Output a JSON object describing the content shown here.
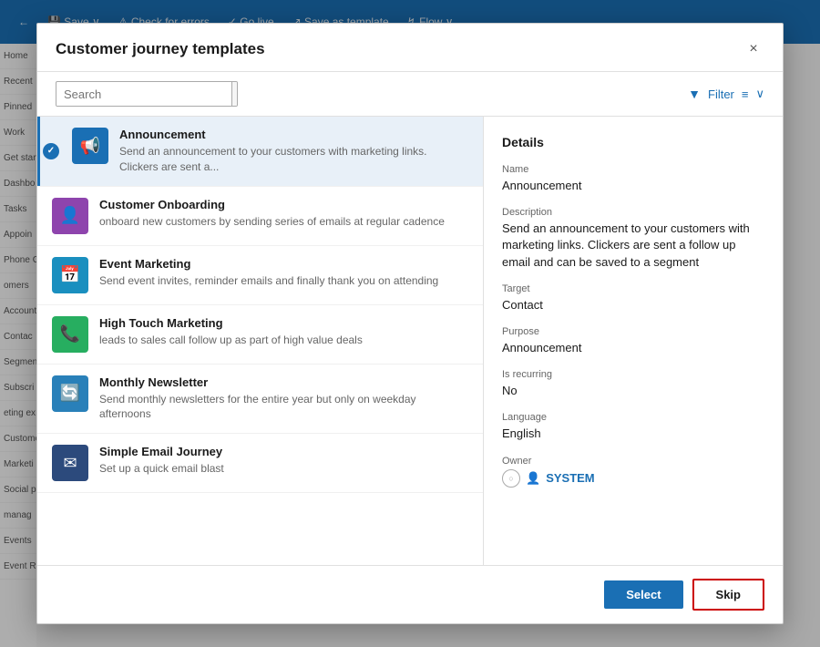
{
  "app": {
    "title": "Customer journey templates",
    "toolbar": {
      "back_label": "←",
      "save_label": "Save",
      "check_errors_label": "Check for errors",
      "go_live_label": "Go live",
      "save_as_template_label": "Save as template",
      "flow_label": "Flow"
    }
  },
  "sidebar": {
    "items": [
      {
        "label": "Home"
      },
      {
        "label": "Recent"
      },
      {
        "label": "Pinned"
      },
      {
        "label": "Work"
      },
      {
        "label": "Get start"
      },
      {
        "label": "Dashbo"
      },
      {
        "label": "Tasks"
      },
      {
        "label": "Appoin"
      },
      {
        "label": "Phone C"
      },
      {
        "label": "omers"
      },
      {
        "label": "Account"
      },
      {
        "label": "Contac"
      },
      {
        "label": "Segmen"
      },
      {
        "label": "Subscri"
      },
      {
        "label": "eting ex"
      },
      {
        "label": "Custome"
      },
      {
        "label": "Marketi"
      },
      {
        "label": "Social p"
      },
      {
        "label": "manag"
      },
      {
        "label": "Events"
      },
      {
        "label": "Event Re"
      }
    ]
  },
  "modal": {
    "title": "Customer journey templates",
    "close_label": "×",
    "search": {
      "placeholder": "Search",
      "value": ""
    },
    "filter": {
      "label": "Filter"
    },
    "templates": [
      {
        "id": "announcement",
        "name": "Announcement",
        "description": "Send an announcement to your customers with marketing links. Clickers are sent a...",
        "icon_color": "#1a6fb4",
        "icon": "📢",
        "selected": true
      },
      {
        "id": "customer-onboarding",
        "name": "Customer Onboarding",
        "description": "onboard new customers by sending series of emails at regular cadence",
        "icon_color": "#8e44ad",
        "icon": "👤",
        "selected": false
      },
      {
        "id": "event-marketing",
        "name": "Event Marketing",
        "description": "Send event invites, reminder emails and finally thank you on attending",
        "icon_color": "#1a8fbf",
        "icon": "📅",
        "selected": false
      },
      {
        "id": "high-touch-marketing",
        "name": "High Touch Marketing",
        "description": "leads to sales call follow up as part of high value deals",
        "icon_color": "#27ae60",
        "icon": "📞",
        "selected": false
      },
      {
        "id": "monthly-newsletter",
        "name": "Monthly Newsletter",
        "description": "Send monthly newsletters for the entire year but only on weekday afternoons",
        "icon_color": "#2980b9",
        "icon": "🔄",
        "selected": false
      },
      {
        "id": "simple-email-journey",
        "name": "Simple Email Journey",
        "description": "Set up a quick email blast",
        "icon_color": "#2c4a7c",
        "icon": "✉",
        "selected": false
      }
    ],
    "details": {
      "section_title": "Details",
      "fields": [
        {
          "label": "Name",
          "value": "Announcement"
        },
        {
          "label": "Description",
          "value": "Send an announcement to your customers with marketing links. Clickers are sent a follow up email and can be saved to a segment"
        },
        {
          "label": "Target",
          "value": "Contact"
        },
        {
          "label": "Purpose",
          "value": "Announcement"
        },
        {
          "label": "Is recurring",
          "value": "No"
        },
        {
          "label": "Language",
          "value": "English"
        },
        {
          "label": "Owner",
          "value": "SYSTEM"
        }
      ]
    },
    "footer": {
      "select_label": "Select",
      "skip_label": "Skip"
    }
  }
}
